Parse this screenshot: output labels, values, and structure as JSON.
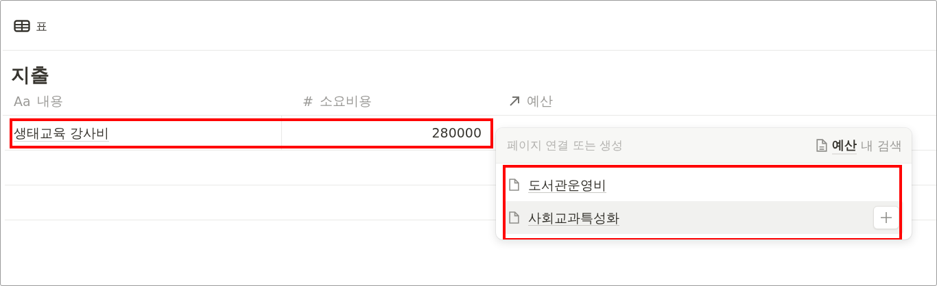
{
  "view": {
    "label": "표"
  },
  "title": "지출",
  "columns": [
    {
      "kind": "title",
      "glyph": "Aa",
      "label": "내용"
    },
    {
      "kind": "number",
      "glyph": "#",
      "label": "소요비용"
    },
    {
      "kind": "relation",
      "label": "예산"
    }
  ],
  "rows": [
    {
      "cells": [
        "생태교육 강사비",
        "280000"
      ],
      "highlighted": true
    }
  ],
  "popup": {
    "placeholder": "페이지 연결 또는 생성",
    "scope": {
      "database": "예산",
      "suffix": "내 검색"
    },
    "highlighted": true,
    "results": [
      {
        "label": "도서관운영비",
        "selected": false
      },
      {
        "label": "사회교과특성화",
        "selected": true
      }
    ]
  }
}
